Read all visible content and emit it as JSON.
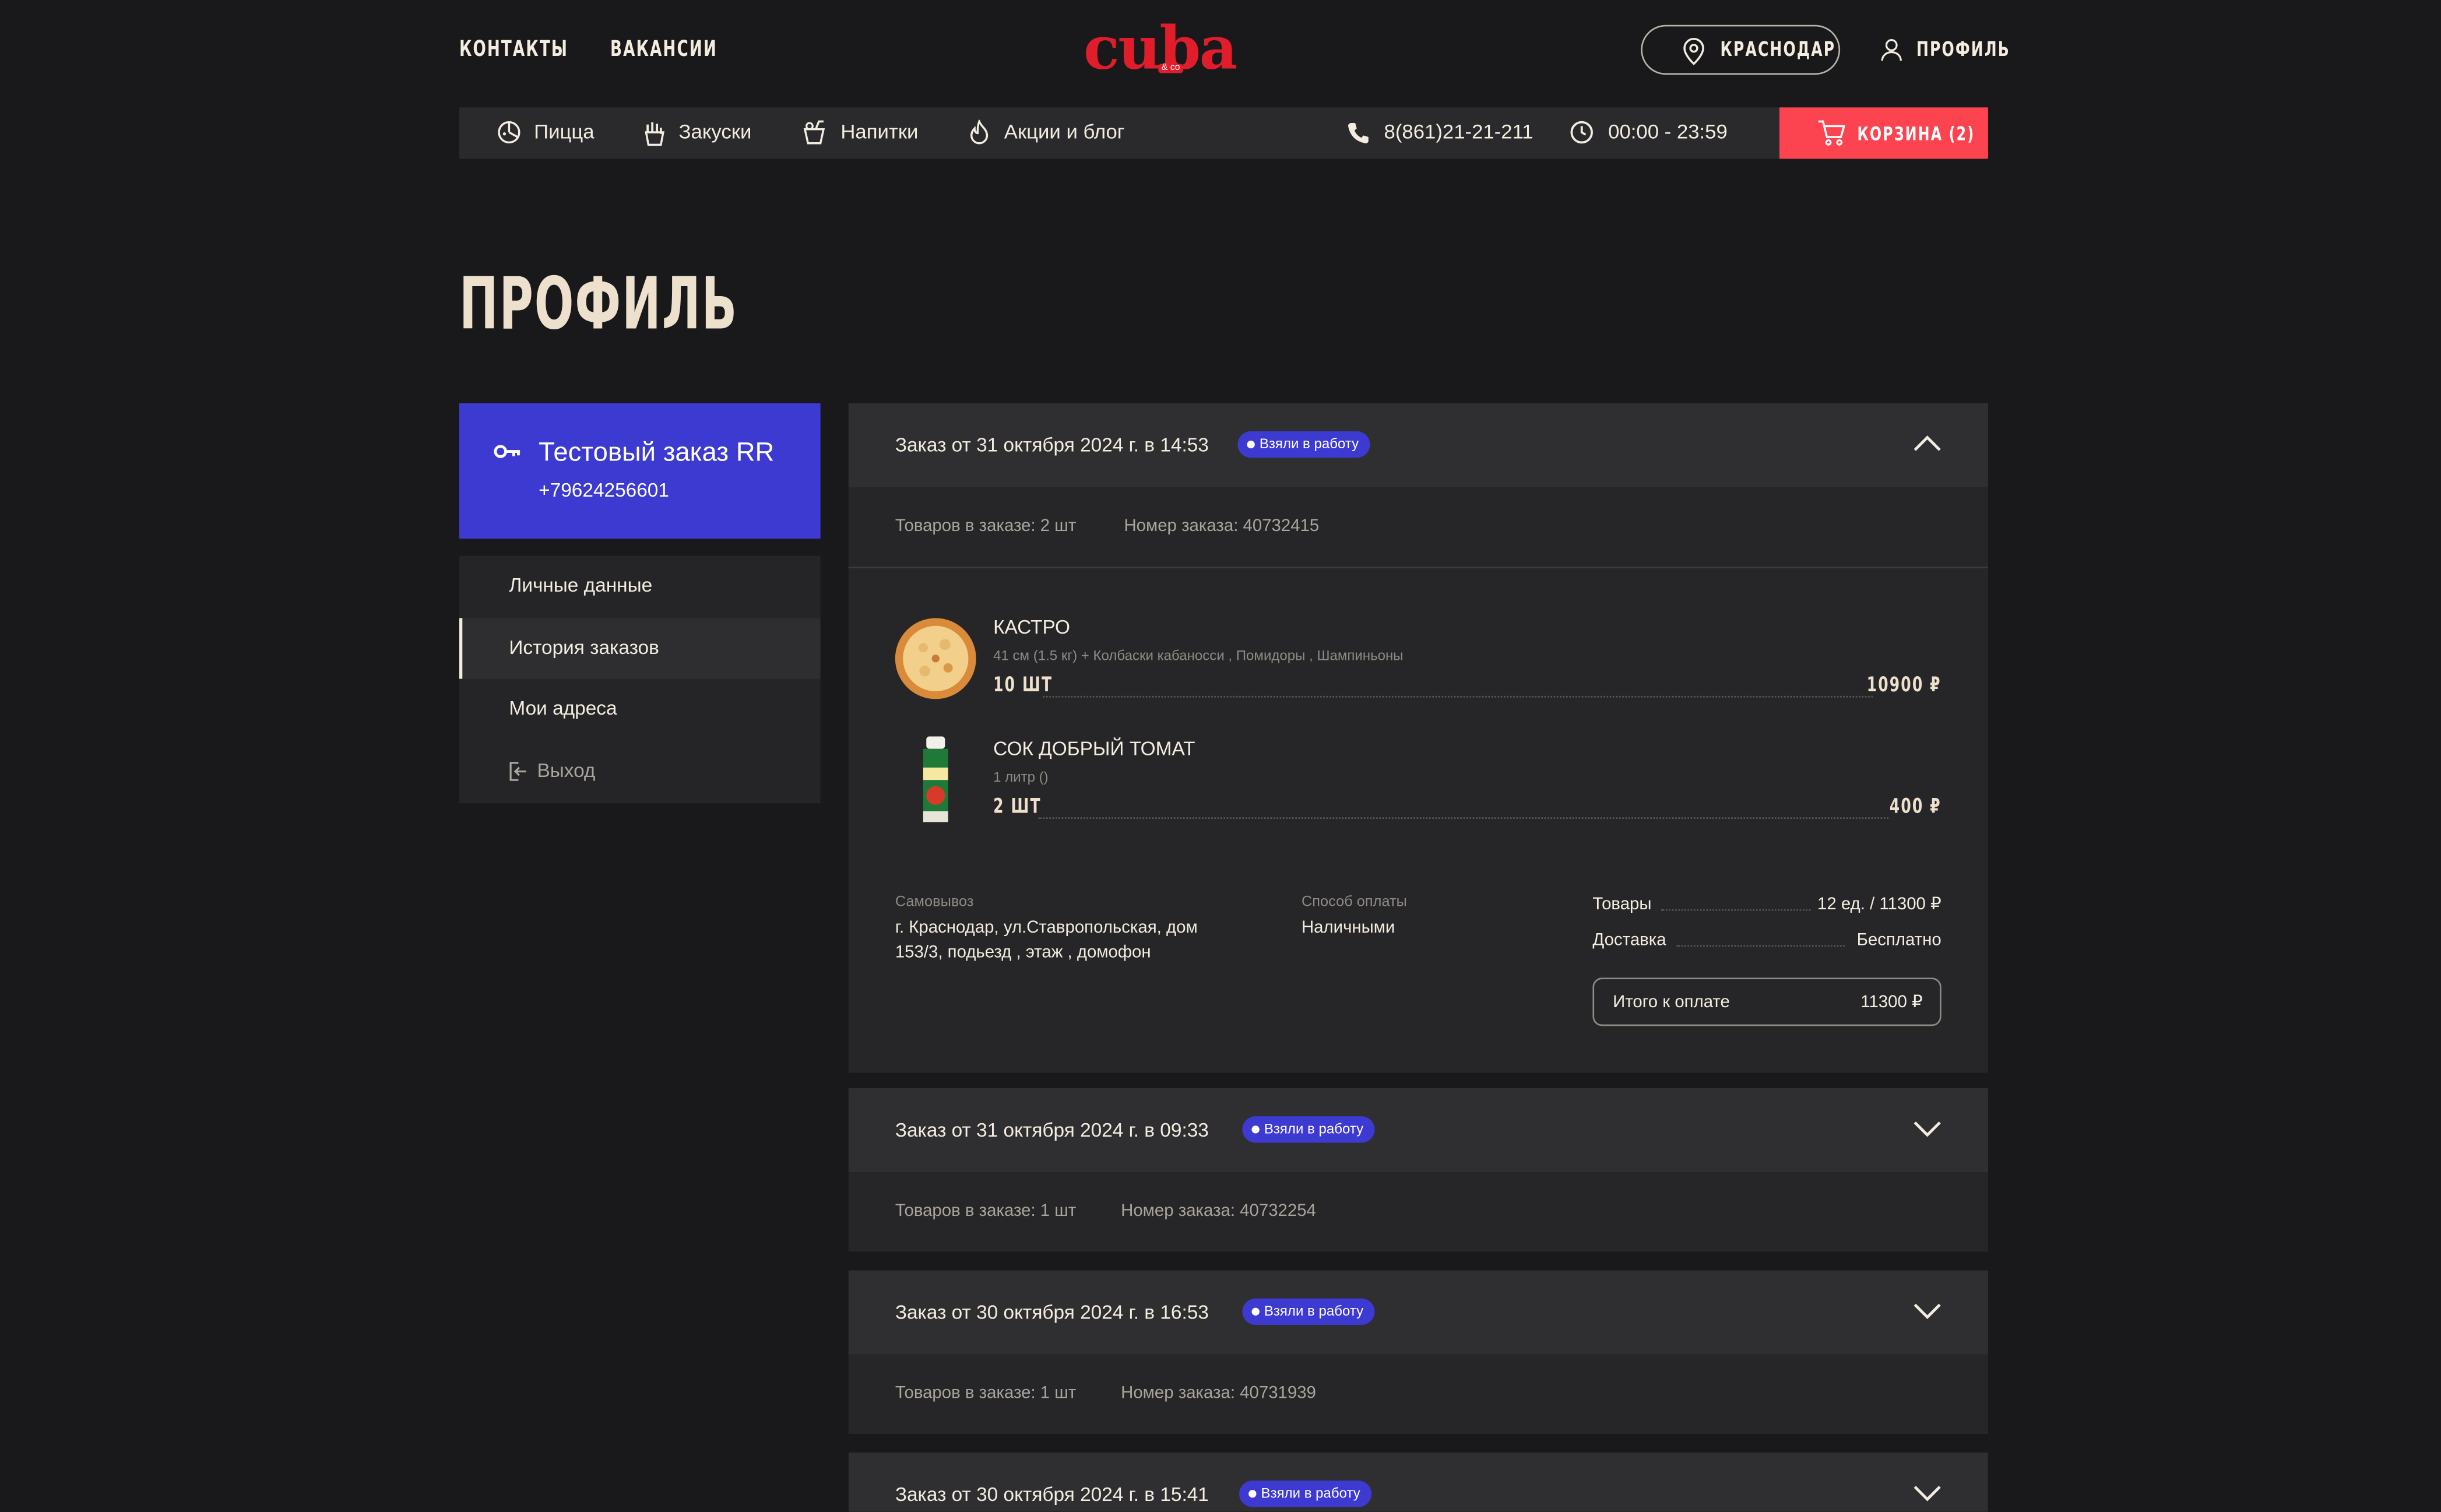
{
  "header": {
    "nav": [
      "КОНТАКТЫ",
      "ВАКАНСИИ"
    ],
    "logo_text": "cuba",
    "logo_sub": "& co",
    "city": "КРАСНОДАР",
    "profile": "ПРОФИЛЬ"
  },
  "catbar": {
    "items": [
      "Пицца",
      "Закуски",
      "Напитки",
      "Акции и блог"
    ],
    "phone": "8(861)21-21-211",
    "hours": "00:00 - 23:59",
    "cart": "КОРЗИНА (2)"
  },
  "page_title": "ПРОФИЛЬ",
  "user": {
    "name": "Тестовый заказ RR",
    "phone": "+79624256601"
  },
  "menu": {
    "personal": "Личные данные",
    "history": "История заказов",
    "addresses": "Мои адреса",
    "logout": "Выход"
  },
  "orders": [
    {
      "title": "Заказ от 31 октября 2024 г. в 14:53",
      "status": "Взяли в работу",
      "items_count": "Товаров в заказе: 2 шт",
      "number": "Номер заказа: 40732415",
      "products": [
        {
          "name": "КАСТРО",
          "desc": "41 см (1.5 кг) + Колбаски кабаносси , Помидоры , Шампиньоны",
          "qty": "10 ШТ",
          "price": "10900 ₽"
        },
        {
          "name": "СОК ДОБРЫЙ ТОМАТ",
          "desc": "1 литр ()",
          "qty": "2 ШТ",
          "price": "400 ₽"
        }
      ],
      "delivery_label": "Самовывоз",
      "address": "г. Краснодар, ул.Ставропольская, дом 153/3, подьезд , этаж , домофон",
      "payment_label": "Способ оплаты",
      "payment": "Наличными",
      "goods_label": "Товары",
      "goods_value": "12 ед. / 11300 ₽",
      "delivery_cost_label": "Доставка",
      "delivery_cost": "Бесплатно",
      "total_label": "Итого к оплате",
      "total": "11300 ₽"
    },
    {
      "title": "Заказ от 31 октября 2024 г. в 09:33",
      "status": "Взяли в работу",
      "items_count": "Товаров в заказе: 1 шт",
      "number": "Номер заказа: 40732254"
    },
    {
      "title": "Заказ от 30 октября 2024 г. в 16:53",
      "status": "Взяли в работу",
      "items_count": "Товаров в заказе: 1 шт",
      "number": "Номер заказа: 40731939"
    },
    {
      "title": "Заказ от 30 октября 2024 г. в 15:41",
      "status": "Взяли в работу"
    }
  ]
}
